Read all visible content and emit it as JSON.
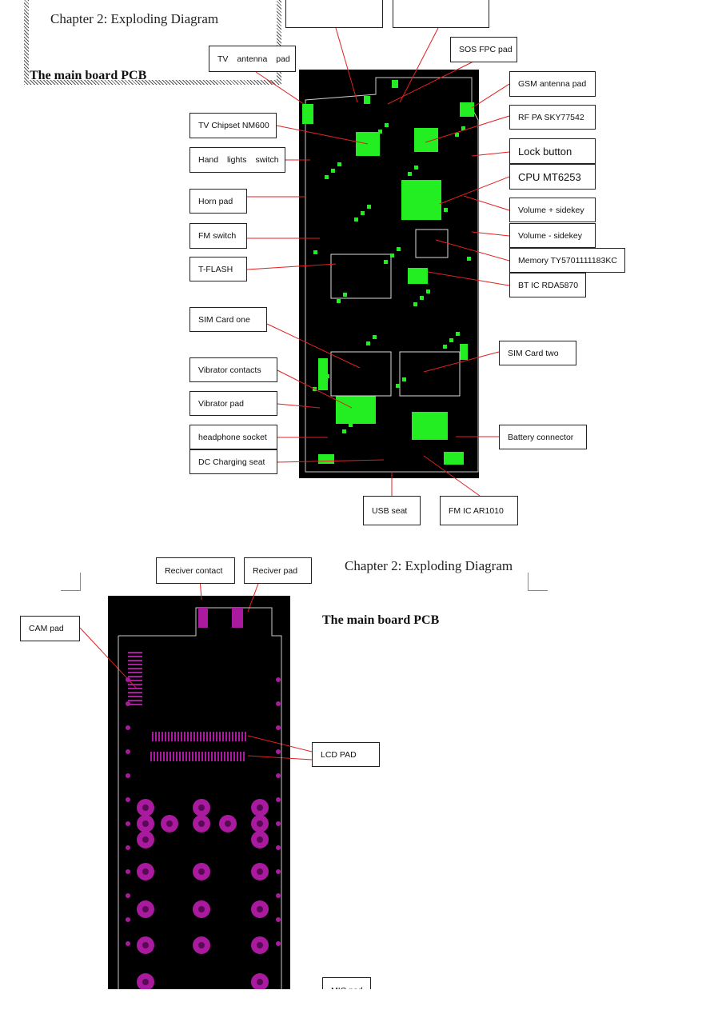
{
  "section1": {
    "heading": "Chapter 2: Exploding Diagram",
    "subheading": "The main board PCB",
    "labels": {
      "top_left": "",
      "top_right": "",
      "sos_fpc": "SOS FPC pad",
      "tv_antenna": "TV antenna pad",
      "gsm_antenna": "GSM antenna pad",
      "tv_chipset": "TV Chipset NM600",
      "rf_pa": "RF PA SKY77542",
      "hand_lights": "Hand lights switch",
      "lock_button": "Lock button",
      "cpu": "CPU MT6253",
      "horn_pad": "Horn pad",
      "volume_plus": "Volume + sidekey",
      "volume_minus": "Volume - sidekey",
      "fm_switch": "FM switch",
      "memory": "Memory TY5701111183KC",
      "tflash": "T-FLASH",
      "bt_ic": "BT IC RDA5870",
      "sim_one": "SIM Card one",
      "sim_two": "SIM Card two",
      "vibrator_contacts": "Vibrator contacts",
      "vibrator_pad": "Vibrator pad",
      "headphone": "headphone socket",
      "battery": "Battery connector",
      "dc_charging": "DC Charging seat",
      "usb": "USB seat",
      "fm_ic": "FM IC AR1010"
    }
  },
  "section2": {
    "heading": "Chapter 2: Exploding Diagram",
    "subheading": "The main board PCB",
    "labels": {
      "reciver_contact": "Reciver contact",
      "reciver_pad": "Reciver pad",
      "cam_pad": "CAM pad",
      "lcd_pad": "LCD PAD",
      "mic_pad": "MIC pad"
    }
  },
  "colors": {
    "pcb_bg": "#000000",
    "top_layer": "#22ee22",
    "bottom_layer": "#aa1a9e",
    "leader_line": "#e02020"
  }
}
